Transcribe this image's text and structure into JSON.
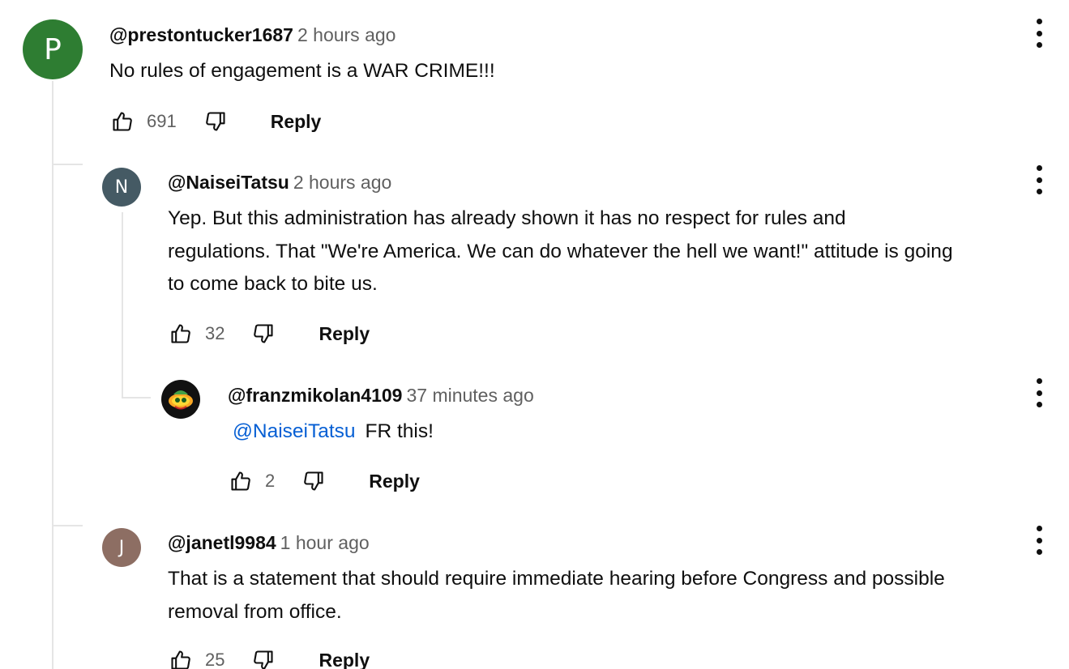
{
  "comments": [
    {
      "avatar_letter": "P",
      "avatar_color": "#2e7d32",
      "handle": "@prestontucker1687",
      "time": "2 hours ago",
      "text": "No rules of engagement is a WAR CRIME!!!",
      "likes": "691",
      "reply_label": "Reply"
    },
    {
      "avatar_letter": "N",
      "avatar_color": "#455a64",
      "handle": "@NaiseiTatsu",
      "time": "2 hours ago",
      "lines": [
        "Yep. But this administration has already shown it has no respect for rules and",
        "regulations. That \"We're America. We can do whatever the hell we want!\" attitude is going",
        "to come back to bite us."
      ],
      "likes": "32",
      "reply_label": "Reply"
    },
    {
      "avatar_color": "#111111",
      "handle": "@franzmikolan4109",
      "time": "37 minutes ago",
      "mention": "@NaiseiTatsu",
      "text": "FR this!",
      "likes": "2",
      "reply_label": "Reply"
    },
    {
      "avatar_letter": "J",
      "avatar_color": "#8d6e63",
      "handle": "@janetl9984",
      "time": "1 hour ago",
      "lines": [
        "That is a statement that should require immediate hearing before Congress and possible",
        "removal from office."
      ],
      "likes": "25",
      "reply_label": "Reply"
    }
  ]
}
